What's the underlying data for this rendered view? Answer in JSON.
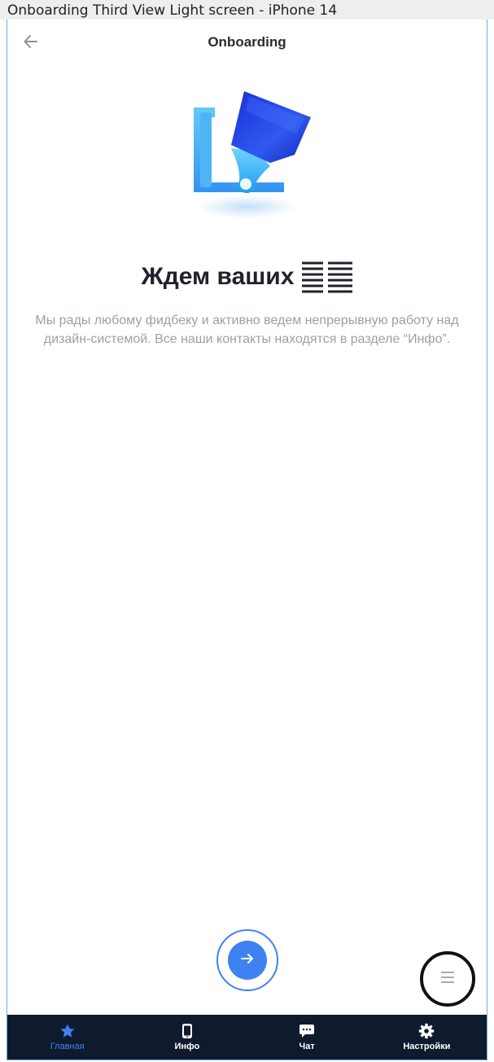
{
  "frame": {
    "title": "Onboarding Third View Light screen - iPhone 14"
  },
  "navbar": {
    "title": "Onboarding"
  },
  "content": {
    "headline": "Ждем ваших",
    "subtitle": "Мы рады любому фидбеку и активно ведем непрерывную работу над дизайн-системой. Все наши контакты находятся в разделе “Инфо”."
  },
  "colors": {
    "accent": "#3d82f0",
    "tabbar_bg": "#101a2e",
    "headline": "#20222c",
    "subtitle": "#9aa0aa"
  },
  "icons": {
    "back": "arrow-left-icon",
    "next": "arrow-right-icon",
    "menu": "hamburger-icon",
    "illustration": "paint-brush-illustration"
  },
  "tabs": [
    {
      "label": "Главная",
      "icon": "star-icon",
      "active": true
    },
    {
      "label": "Инфо",
      "icon": "phone-icon",
      "active": false
    },
    {
      "label": "Чат",
      "icon": "chat-icon",
      "active": false
    },
    {
      "label": "Настройки",
      "icon": "gear-icon",
      "active": false
    }
  ]
}
